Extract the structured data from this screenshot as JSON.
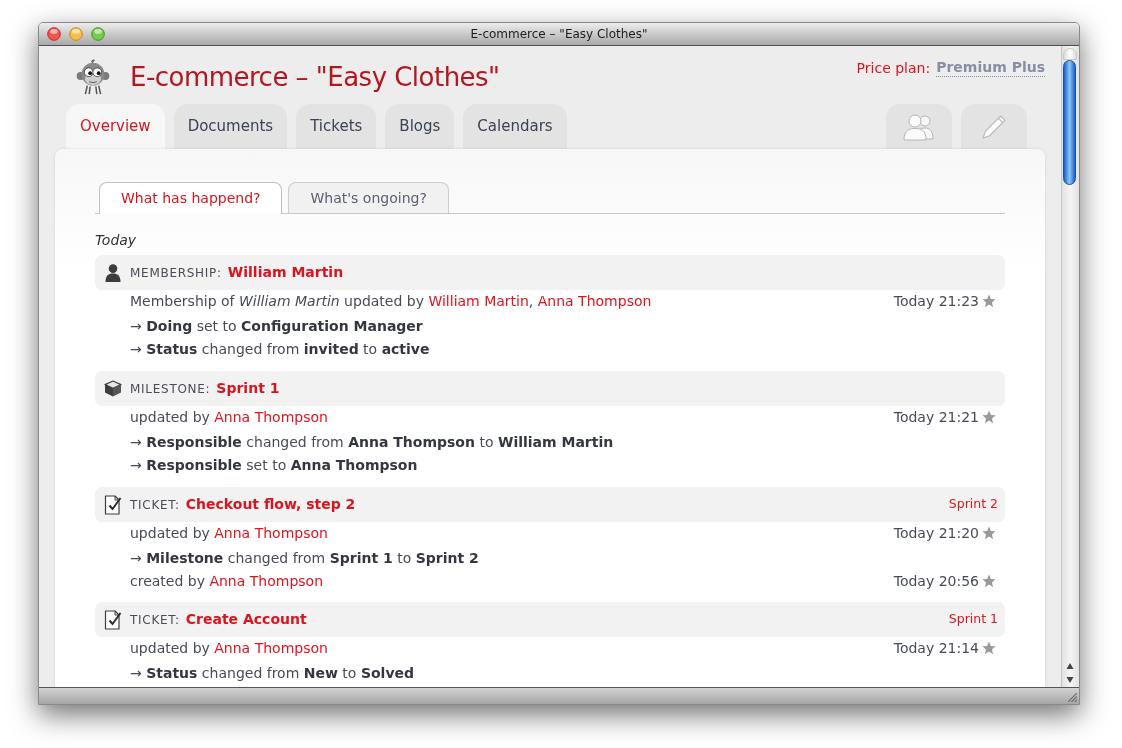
{
  "window": {
    "title": "E-commerce – \"Easy Clothes\""
  },
  "header": {
    "title": "E-commerce – \"Easy Clothes\"",
    "price_plan": {
      "label": "Price plan:",
      "value": "Premium Plus"
    }
  },
  "tabs": [
    {
      "label": "Overview",
      "selected": true
    },
    {
      "label": "Documents",
      "selected": false
    },
    {
      "label": "Tickets",
      "selected": false
    },
    {
      "label": "Blogs",
      "selected": false
    },
    {
      "label": "Calendars",
      "selected": false
    }
  ],
  "icon_tabs": [
    {
      "kind": "members",
      "selected": false
    },
    {
      "kind": "edit",
      "selected": false
    }
  ],
  "subtabs": [
    {
      "label": "What has happend?",
      "selected": true
    },
    {
      "label": "What's ongoing?",
      "selected": false
    }
  ],
  "activity": {
    "day": "Today",
    "entries": [
      {
        "kind": "membership",
        "type_label": "MEMBERSHIP:",
        "title": "William Martin",
        "events": [
          {
            "text": "Membership of *William Martin* updated by",
            "links": [
              "William Martin",
              "Anna Thompson"
            ],
            "separator": ",",
            "time": "Today 21:23",
            "starred": false,
            "changes": [
              "→ **Doing** set to **Configuration Manager**",
              "→ **Status** changed from **invited** to **active**"
            ]
          }
        ]
      },
      {
        "kind": "milestone",
        "type_label": "MILESTONE:",
        "title": "Sprint 1",
        "events": [
          {
            "text": "updated by",
            "links": [
              "Anna Thompson"
            ],
            "time": "Today 21:21",
            "starred": false,
            "changes": [
              "→ **Responsible** changed from **Anna Thompson** to **William Martin**",
              "→ **Responsible** set to **Anna Thompson**"
            ]
          }
        ]
      },
      {
        "kind": "ticket",
        "type_label": "TICKET:",
        "title": "Checkout flow, step 2",
        "milestone": "Sprint 2",
        "events": [
          {
            "text": "updated by",
            "links": [
              "Anna Thompson"
            ],
            "time": "Today 21:20",
            "starred": false,
            "changes": [
              "→ **Milestone** changed from **Sprint 1** to **Sprint 2**"
            ]
          },
          {
            "text": "created by",
            "links": [
              "Anna Thompson"
            ],
            "time": "Today 20:56",
            "starred": false
          }
        ]
      },
      {
        "kind": "ticket",
        "type_label": "TICKET:",
        "title": "Create Account",
        "milestone": "Sprint 1",
        "events": [
          {
            "text": "updated by",
            "links": [
              "Anna Thompson"
            ],
            "time": "Today 21:14",
            "starred": false,
            "changes": [
              "→ **Status** changed from **New** to **Solved**"
            ]
          }
        ]
      }
    ]
  }
}
